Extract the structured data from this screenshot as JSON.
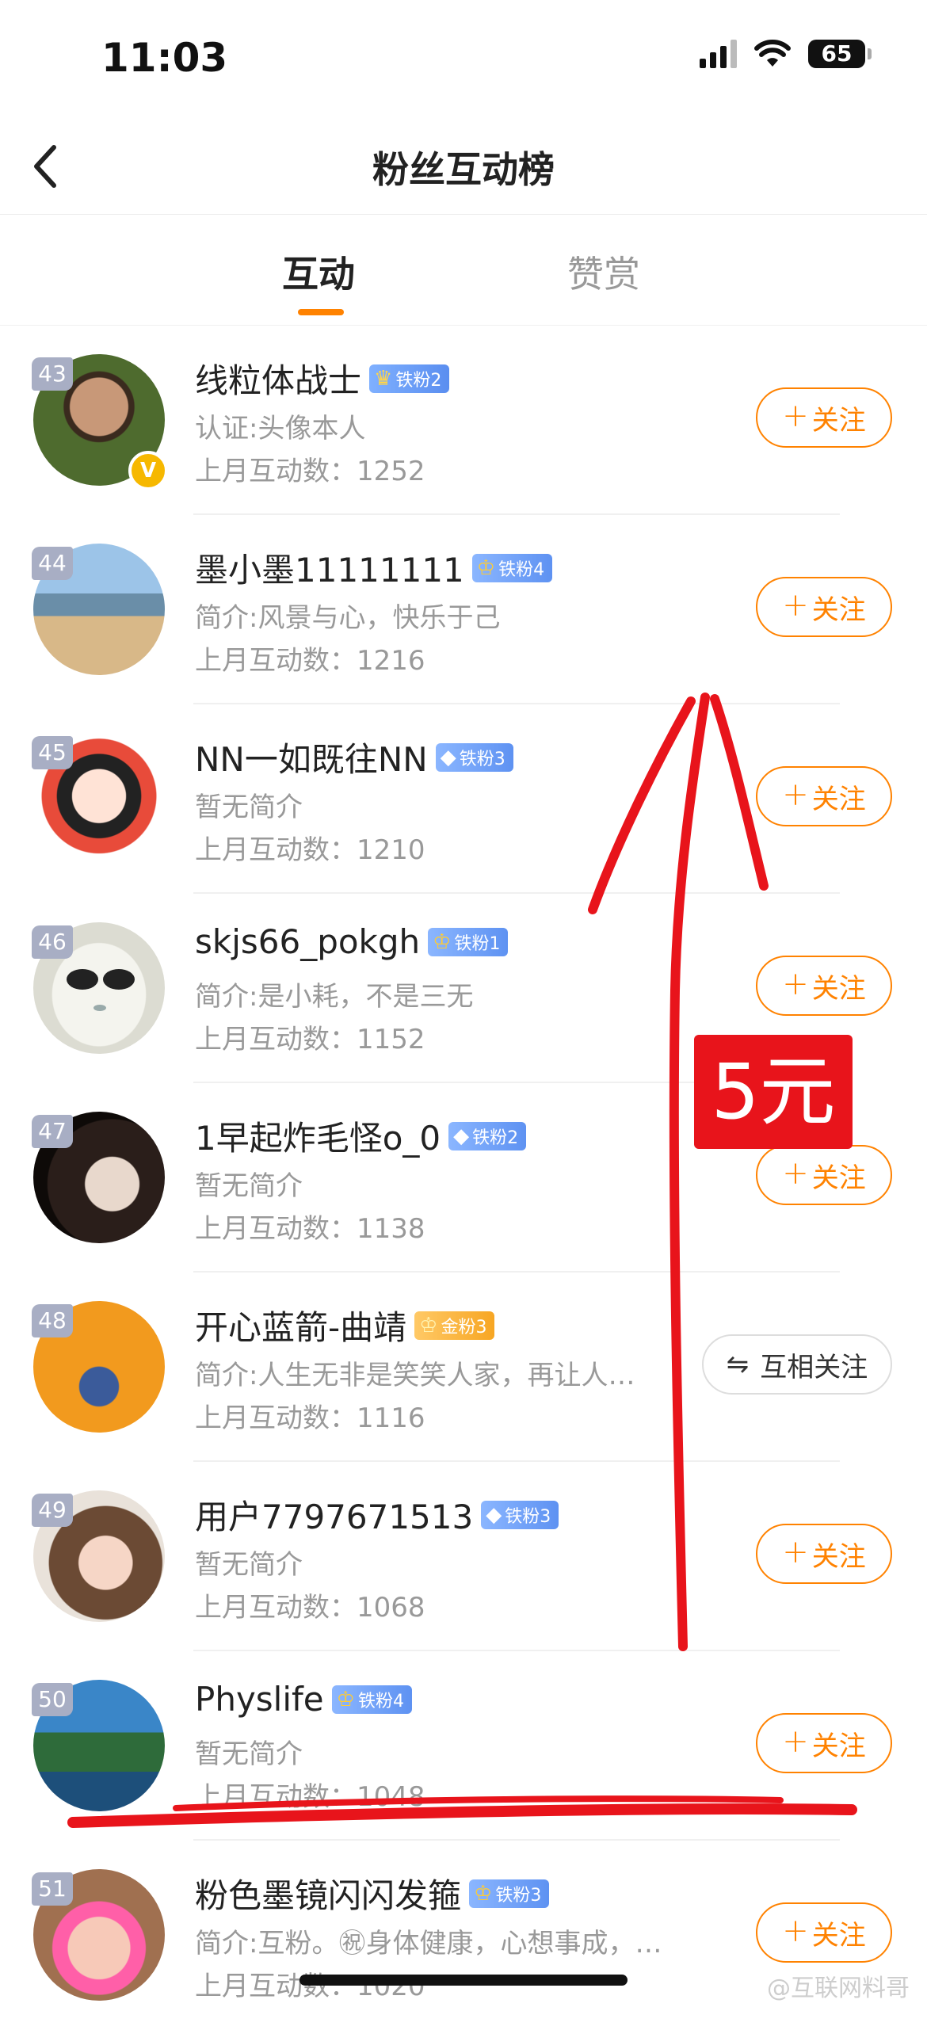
{
  "status_bar": {
    "time": "11:03",
    "battery": "65"
  },
  "nav": {
    "title": "粉丝互动榜"
  },
  "tabs": [
    {
      "label": "互动",
      "active": true
    },
    {
      "label": "赞赏",
      "active": false
    }
  ],
  "colors": {
    "accent": "#ff8200",
    "annotation_red": "#e8141b"
  },
  "users": [
    {
      "rank": "43",
      "name": "线粒体战士",
      "badge": "铁粉2",
      "badge_type": "iron",
      "badge_icon": "crown-star-icon",
      "desc": "认证:头像本人",
      "count_label": "上月互动数：",
      "count": "1252",
      "button": "关注",
      "verified": true
    },
    {
      "rank": "44",
      "name": "墨小墨11111111",
      "badge": "铁粉4",
      "badge_type": "iron",
      "badge_icon": "crown-icon",
      "desc": "简介:风景与心，快乐于己",
      "count_label": "上月互动数：",
      "count": "1216",
      "button": "关注"
    },
    {
      "rank": "45",
      "name": "NN一如既往NN",
      "badge": "铁粉3",
      "badge_type": "iron",
      "badge_icon": "diamond-icon",
      "desc": "暂无简介",
      "count_label": "上月互动数：",
      "count": "1210",
      "button": "关注"
    },
    {
      "rank": "46",
      "name": "skjs66_pokgh",
      "badge": "铁粉1",
      "badge_type": "iron",
      "badge_icon": "crown-icon",
      "desc": "简介:是小耗，不是三无",
      "count_label": "上月互动数：",
      "count": "1152",
      "button": "关注"
    },
    {
      "rank": "47",
      "name": "1早起炸毛怪o_0",
      "badge": "铁粉2",
      "badge_type": "iron",
      "badge_icon": "diamond-icon",
      "desc": "暂无简介",
      "count_label": "上月互动数：",
      "count": "1138",
      "button": "关注"
    },
    {
      "rank": "48",
      "name": "开心蓝箭-曲靖",
      "badge": "金粉3",
      "badge_type": "gold",
      "badge_icon": "crown-icon",
      "desc": "简介:人生无非是笑笑人家，再让人…",
      "count_label": "上月互动数：",
      "count": "1116",
      "button": "互相关注",
      "mutual": true
    },
    {
      "rank": "49",
      "name": "用户7797671513",
      "badge": "铁粉3",
      "badge_type": "iron",
      "badge_icon": "diamond-icon",
      "desc": "暂无简介",
      "count_label": "上月互动数：",
      "count": "1068",
      "button": "关注"
    },
    {
      "rank": "50",
      "name": "Physlife",
      "badge": "铁粉4",
      "badge_type": "iron",
      "badge_icon": "crown-icon",
      "desc": "暂无简介",
      "count_label": "上月互动数：",
      "count": "1048",
      "button": "关注"
    },
    {
      "rank": "51",
      "name": "粉色墨镜闪闪发箍",
      "badge": "铁粉3",
      "badge_type": "iron",
      "badge_icon": "crown-icon",
      "desc": "简介:互粉。㊗身体健康，心想事成，万…",
      "count_label": "上月互动数：",
      "count": "1020",
      "button": "关注"
    }
  ],
  "annotation": {
    "price": "5元"
  },
  "watermark": "@互联网料哥"
}
